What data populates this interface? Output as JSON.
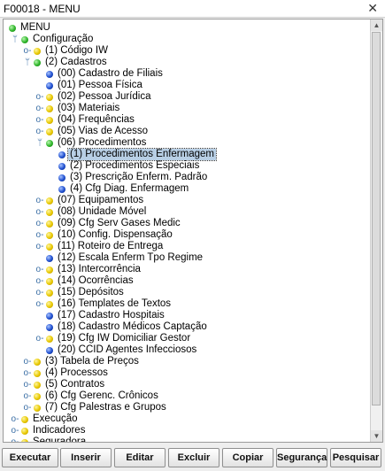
{
  "window": {
    "title": "F00018 - MENU",
    "close_glyph": "✕"
  },
  "tree": [
    {
      "label": "MENU",
      "depth": 0,
      "color": "green",
      "handle": "none"
    },
    {
      "label": "Configuração",
      "depth": 1,
      "color": "green",
      "handle": "expanded"
    },
    {
      "label": "(1) Código IW",
      "depth": 2,
      "color": "yellow",
      "handle": "collapsed"
    },
    {
      "label": "(2) Cadastros",
      "depth": 2,
      "color": "green",
      "handle": "expanded"
    },
    {
      "label": "(00) Cadastro de Filiais",
      "depth": 3,
      "color": "blue",
      "handle": "none"
    },
    {
      "label": "(01) Pessoa Física",
      "depth": 3,
      "color": "blue",
      "handle": "none"
    },
    {
      "label": "(02) Pessoa Jurídica",
      "depth": 3,
      "color": "yellow",
      "handle": "collapsed"
    },
    {
      "label": "(03) Materiais",
      "depth": 3,
      "color": "yellow",
      "handle": "collapsed"
    },
    {
      "label": "(04) Frequências",
      "depth": 3,
      "color": "yellow",
      "handle": "collapsed"
    },
    {
      "label": "(05) Vias de Acesso",
      "depth": 3,
      "color": "yellow",
      "handle": "collapsed"
    },
    {
      "label": "(06) Procedimentos",
      "depth": 3,
      "color": "green",
      "handle": "expanded"
    },
    {
      "label": "(1) Procedimentos Enfermagem",
      "depth": 4,
      "color": "blue",
      "handle": "none",
      "selected": true
    },
    {
      "label": "(2) Procedimentos Especiais",
      "depth": 4,
      "color": "blue",
      "handle": "none"
    },
    {
      "label": "(3) Prescrição Enferm. Padrão",
      "depth": 4,
      "color": "blue",
      "handle": "none"
    },
    {
      "label": "(4) Cfg Diag. Enfermagem",
      "depth": 4,
      "color": "blue",
      "handle": "none"
    },
    {
      "label": "(07) Equipamentos",
      "depth": 3,
      "color": "yellow",
      "handle": "collapsed"
    },
    {
      "label": "(08) Unidade Móvel",
      "depth": 3,
      "color": "yellow",
      "handle": "collapsed"
    },
    {
      "label": "(09) Cfg Serv Gases Medic",
      "depth": 3,
      "color": "yellow",
      "handle": "collapsed"
    },
    {
      "label": "(10) Config. Dispensação",
      "depth": 3,
      "color": "yellow",
      "handle": "collapsed"
    },
    {
      "label": "(11) Roteiro de Entrega",
      "depth": 3,
      "color": "yellow",
      "handle": "collapsed"
    },
    {
      "label": "(12) Escala Enferm Tpo Regime",
      "depth": 3,
      "color": "blue",
      "handle": "none"
    },
    {
      "label": "(13) Intercorrência",
      "depth": 3,
      "color": "yellow",
      "handle": "collapsed"
    },
    {
      "label": "(14) Ocorrências",
      "depth": 3,
      "color": "yellow",
      "handle": "collapsed"
    },
    {
      "label": "(15) Depósitos",
      "depth": 3,
      "color": "yellow",
      "handle": "collapsed"
    },
    {
      "label": "(16) Templates de Textos",
      "depth": 3,
      "color": "yellow",
      "handle": "collapsed"
    },
    {
      "label": "(17) Cadastro Hospitais",
      "depth": 3,
      "color": "blue",
      "handle": "none"
    },
    {
      "label": "(18) Cadastro Médicos Captação",
      "depth": 3,
      "color": "blue",
      "handle": "none"
    },
    {
      "label": "(19) Cfg IW Domiciliar Gestor",
      "depth": 3,
      "color": "yellow",
      "handle": "collapsed"
    },
    {
      "label": "(20) CCID Agentes Infecciosos",
      "depth": 3,
      "color": "blue",
      "handle": "none"
    },
    {
      "label": "(3) Tabela de Preços",
      "depth": 2,
      "color": "yellow",
      "handle": "collapsed"
    },
    {
      "label": "(4) Processos",
      "depth": 2,
      "color": "yellow",
      "handle": "collapsed"
    },
    {
      "label": "(5) Contratos",
      "depth": 2,
      "color": "yellow",
      "handle": "collapsed"
    },
    {
      "label": "(6) Cfg Gerenc. Crônicos",
      "depth": 2,
      "color": "yellow",
      "handle": "collapsed"
    },
    {
      "label": "(7) Cfg Palestras e Grupos",
      "depth": 2,
      "color": "yellow",
      "handle": "collapsed"
    },
    {
      "label": "Execução",
      "depth": 1,
      "color": "yellow",
      "handle": "collapsed"
    },
    {
      "label": "Indicadores",
      "depth": 1,
      "color": "yellow",
      "handle": "collapsed"
    },
    {
      "label": "Seguradora",
      "depth": 1,
      "color": "yellow",
      "handle": "collapsed"
    }
  ],
  "colors": {
    "yellow": "#e8c800",
    "green": "#2fb52a",
    "blue": "#1f4fd0",
    "selection": "#b8cfe5"
  },
  "toolbar": {
    "buttons": [
      "Executar",
      "Inserir",
      "Editar",
      "Excluir",
      "Copiar",
      "Segurança",
      "Pesquisar"
    ]
  }
}
